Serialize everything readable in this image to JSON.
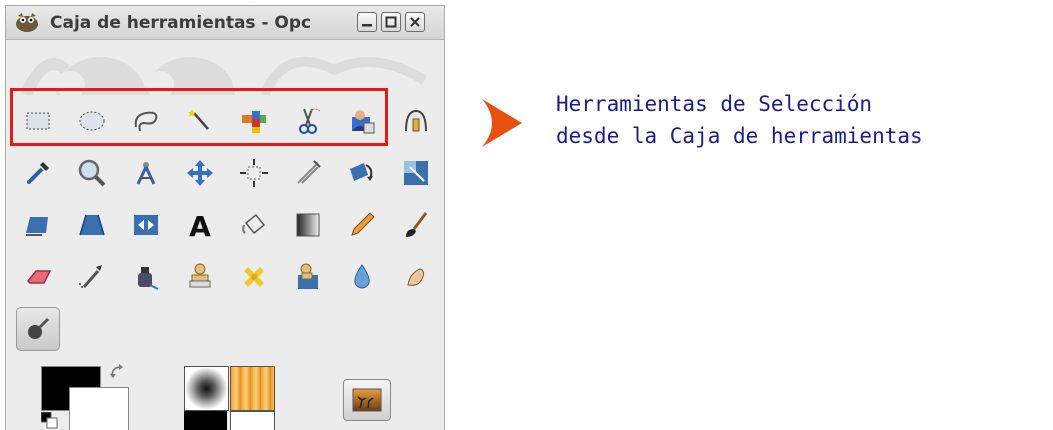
{
  "window": {
    "title": "Caja de herramientas - Opc",
    "buttons": [
      "minimize",
      "maximize",
      "close"
    ]
  },
  "tools": [
    {
      "name": "rect-select-icon",
      "label": "Selección rectangular"
    },
    {
      "name": "ellipse-select-icon",
      "label": "Selección elíptica"
    },
    {
      "name": "free-select-icon",
      "label": "Selección libre"
    },
    {
      "name": "fuzzy-select-icon",
      "label": "Selección difusa"
    },
    {
      "name": "by-color-select-icon",
      "label": "Selección por color"
    },
    {
      "name": "scissors-select-icon",
      "label": "Tijeras inteligentes"
    },
    {
      "name": "foreground-select-icon",
      "label": "Selección de primer plano"
    },
    {
      "name": "paths-icon",
      "label": "Rutas"
    },
    {
      "name": "color-picker-icon",
      "label": "Recoge-color"
    },
    {
      "name": "zoom-icon",
      "label": "Ampliación"
    },
    {
      "name": "measure-icon",
      "label": "Medida"
    },
    {
      "name": "move-icon",
      "label": "Mover"
    },
    {
      "name": "align-icon",
      "label": "Alinear"
    },
    {
      "name": "crop-icon",
      "label": "Recortar"
    },
    {
      "name": "rotate-icon",
      "label": "Rotar"
    },
    {
      "name": "scale-icon",
      "label": "Escalar"
    },
    {
      "name": "shear-icon",
      "label": "Inclinar"
    },
    {
      "name": "perspective-icon",
      "label": "Perspectiva"
    },
    {
      "name": "flip-icon",
      "label": "Voltear"
    },
    {
      "name": "text-icon",
      "label": "Texto"
    },
    {
      "name": "bucket-fill-icon",
      "label": "Relleno"
    },
    {
      "name": "blend-icon",
      "label": "Mezcla"
    },
    {
      "name": "pencil-icon",
      "label": "Lápiz"
    },
    {
      "name": "paintbrush-icon",
      "label": "Pincel"
    },
    {
      "name": "eraser-icon",
      "label": "Goma"
    },
    {
      "name": "airbrush-icon",
      "label": "Aerógrafo"
    },
    {
      "name": "ink-icon",
      "label": "Tinta"
    },
    {
      "name": "clone-icon",
      "label": "Clonar"
    },
    {
      "name": "heal-icon",
      "label": "Saneado"
    },
    {
      "name": "perspective-clone-icon",
      "label": "Clonado en perspectiva"
    },
    {
      "name": "blur-sharpen-icon",
      "label": "Desenfocar"
    },
    {
      "name": "smudge-icon",
      "label": "Emborronar"
    },
    {
      "name": "dodge-burn-icon",
      "label": "Blanquear/Ennegrecer"
    }
  ],
  "caption": {
    "line1": "Herramientas de Selección",
    "line2": "desde la Caja de herramientas"
  },
  "colors": {
    "highlight": "#e51a1a",
    "caption": "#1a1a99",
    "foreground": "#000000",
    "background": "#ffffff"
  }
}
